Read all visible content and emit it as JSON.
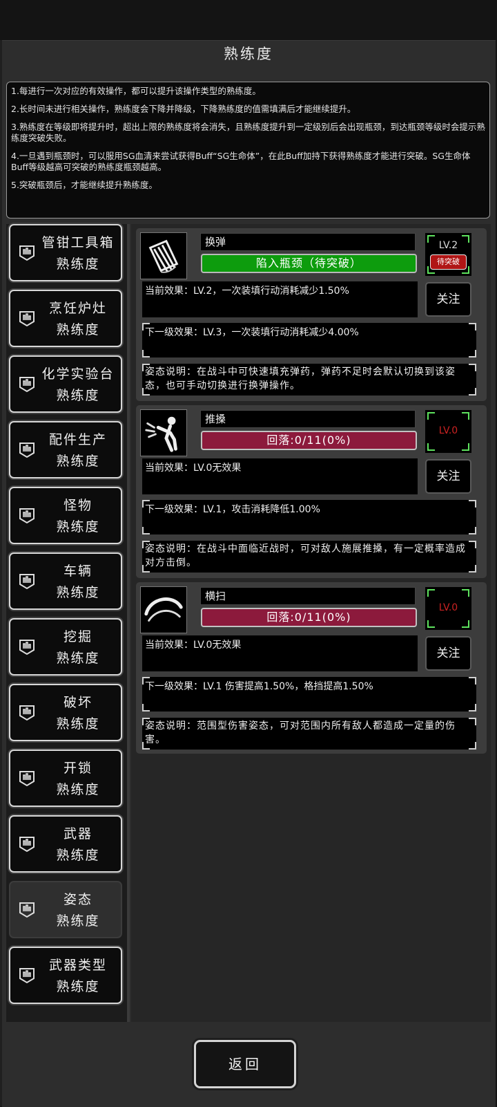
{
  "title": "熟练度",
  "info_lines": [
    "1.每进行一次对应的有效操作，都可以提升该操作类型的熟练度。",
    "2.长时间未进行相关操作，熟练度会下降并降级，下降熟练度的值需填满后才能继续提升。",
    "3.熟练度在等级即将提升时，超出上限的熟练度将会消失，且熟练度提升到一定级别后会出现瓶颈，到达瓶颈等级时会提示熟练度突破失败。",
    "4.一旦遇到瓶颈时，可以服用SG血清来尝试获得Buff“SG生命体”，在此Buff加持下获得熟练度才能进行突破。SG生命体Buff等级越高可突破的熟练度瓶颈越高。",
    "5.突破瓶颈后，才能继续提升熟练度。"
  ],
  "sidebar": {
    "suffix": "熟练度",
    "items": [
      {
        "label": "管钳工具箱",
        "active": false
      },
      {
        "label": "烹饪炉灶",
        "active": false
      },
      {
        "label": "化学实验台",
        "active": false
      },
      {
        "label": "配件生产",
        "active": false
      },
      {
        "label": "怪物",
        "active": false
      },
      {
        "label": "车辆",
        "active": false
      },
      {
        "label": "挖掘",
        "active": false
      },
      {
        "label": "破坏",
        "active": false
      },
      {
        "label": "开锁",
        "active": false
      },
      {
        "label": "武器",
        "active": false
      },
      {
        "label": "姿态",
        "active": true
      },
      {
        "label": "武器类型",
        "active": false
      }
    ]
  },
  "skills": [
    {
      "name": "换弹",
      "icon": "reload-icon",
      "bar_text": "陷入瓶颈（待突破）",
      "bar_color": "#0d9c0d",
      "level": "LV.2",
      "break_badge": "待突破",
      "current_effect": "当前效果：LV.2，一次装填行动消耗减少1.50%",
      "follow_label": "关注",
      "next_effect": "下一级效果：LV.3，一次装填行动消耗减少4.00%",
      "description": "姿态说明：在战斗中可快速填充弹药，弹药不足时会默认切换到该姿态，也可手动切换进行换弹操作。"
    },
    {
      "name": "推搡",
      "icon": "push-icon",
      "bar_text": "回落:0/11(0%)",
      "bar_color": "#8c1a3c",
      "level": "LV.0",
      "break_badge": "",
      "current_effect": "当前效果：LV.0无效果",
      "follow_label": "关注",
      "next_effect": "下一级效果：LV.1，攻击消耗降低1.00%",
      "description": "姿态说明：在战斗中面临近战时，可对敌人施展推搡，有一定概率造成对方击倒。"
    },
    {
      "name": "横扫",
      "icon": "sweep-icon",
      "bar_text": "回落:0/11(0%)",
      "bar_color": "#8c1a3c",
      "level": "LV.0",
      "break_badge": "",
      "current_effect": "当前效果：LV.0无效果",
      "follow_label": "关注",
      "next_effect": "下一级效果：LV.1 伤害提高1.50%，格挡提高1.50%",
      "description": "姿态说明：范围型伤害姿态，可对范围内所有敌人都造成一定量的伤害。"
    }
  ],
  "back_label": "返回"
}
